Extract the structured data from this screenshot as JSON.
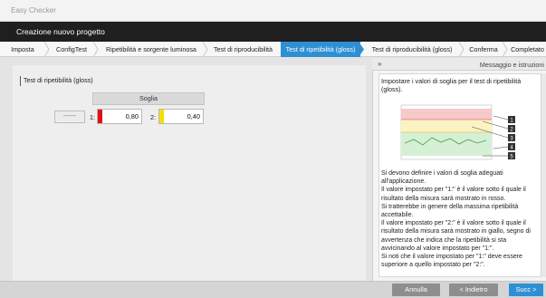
{
  "window": {
    "title": "Easy Checker"
  },
  "header": {
    "title": "Creazione nuovo progetto"
  },
  "tabs": [
    {
      "label": "Imposta"
    },
    {
      "label": "ConfigTest"
    },
    {
      "label": "Ripetibilità e sorgente luminosa"
    },
    {
      "label": "Test di riproducibilità"
    },
    {
      "label": "Test di ripetibilità (gloss)"
    },
    {
      "label": "Test di riproducibilità (gloss)"
    },
    {
      "label": "Conferma"
    },
    {
      "label": "Completato"
    }
  ],
  "main": {
    "section_title": "Test di ripetibilità (gloss)",
    "threshold_header": "Soglia",
    "placeholder": "------",
    "threshold1": {
      "label": "1:",
      "value": "0,80",
      "color": "#e01010"
    },
    "threshold2": {
      "label": "2:",
      "value": "0,40",
      "color": "#f4e000"
    }
  },
  "side_panel": {
    "toggle_glyph": "»",
    "title": "Messaggio e istruzioni",
    "intro": "Impostare i valori di soglia per il test di ripetibilità (gloss).",
    "figure_callouts": [
      "1",
      "2",
      "3",
      "4",
      "5"
    ],
    "body": "Si devono definire i valori di soglia adeguati all'applicazione.\nIl valore impostato per \"1:\" è il valore sotto il quale il risultato della misura sarà mostrato in rosso.\nSi tratterebbe in genere della massima ripetibilità accettabile.\nIl valore impostato per \"2:\" è il valore sotto il quale il risultato della misura sarà mostrato in giallo, segno di avvertenza che indica che la ripetibilità si sta avvicinando al valore impostato per \"1:\".\nSi noti che il valore impostato per \"1:\" deve essere superiore a quello impostato per \"2:\"."
  },
  "footer": {
    "cancel_label": "Annulla",
    "back_label": "< Indietro",
    "next_label": "Succ >"
  },
  "colors": {
    "accent": "#2f8fd4",
    "header_bg": "#1f1f1f",
    "button_gray": "#8e8e8e"
  }
}
